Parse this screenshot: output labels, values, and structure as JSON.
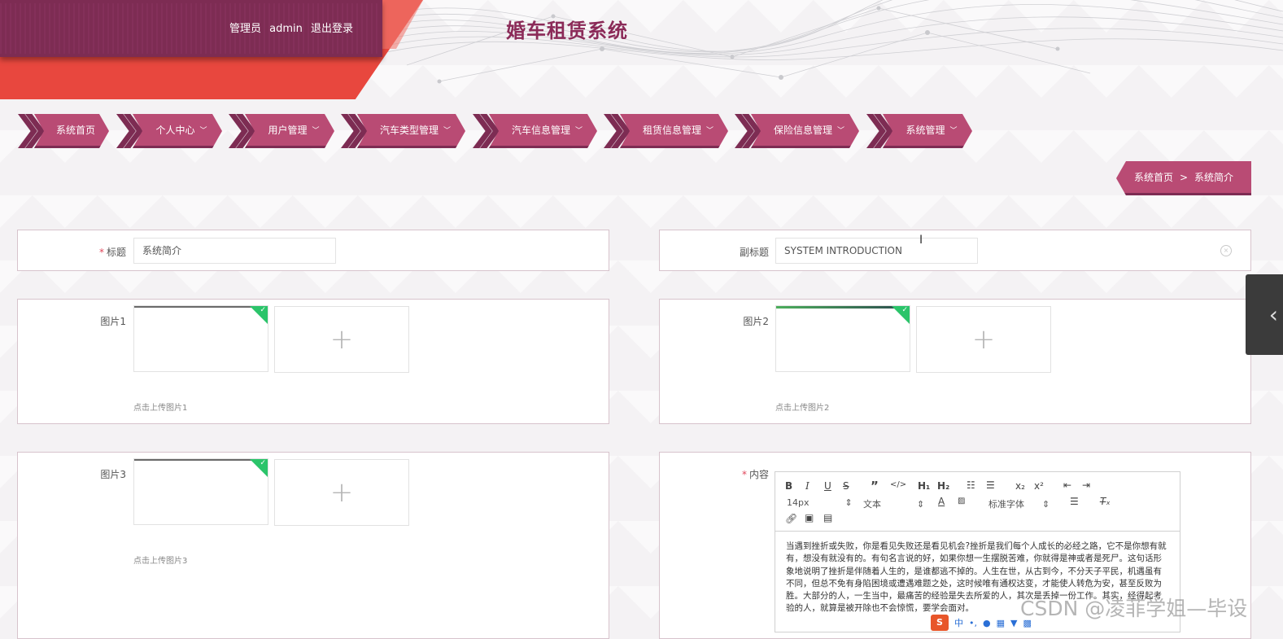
{
  "header": {
    "role_label": "管理员",
    "username": "admin",
    "logout_label": "退出登录",
    "site_title": "婚车租赁系统"
  },
  "nav": {
    "items": [
      {
        "label": "系统首页",
        "has_dropdown": false
      },
      {
        "label": "个人中心",
        "has_dropdown": true
      },
      {
        "label": "用户管理",
        "has_dropdown": true
      },
      {
        "label": "汽车类型管理",
        "has_dropdown": true
      },
      {
        "label": "汽车信息管理",
        "has_dropdown": true
      },
      {
        "label": "租赁信息管理",
        "has_dropdown": true
      },
      {
        "label": "保险信息管理",
        "has_dropdown": true
      },
      {
        "label": "系统管理",
        "has_dropdown": true
      }
    ]
  },
  "breadcrumb": {
    "home": "系统首页",
    "separator": ">",
    "current": "系统简介"
  },
  "form": {
    "title_label": "标题",
    "title_value": "系统简介",
    "subtitle_label": "副标题",
    "subtitle_value": "SYSTEM INTRODUCTION",
    "image1_label": "图片1",
    "image1_hint": "点击上传图片1",
    "image2_label": "图片2",
    "image2_hint": "点击上传图片2",
    "image3_label": "图片3",
    "image3_hint": "点击上传图片3",
    "content_label": "内容",
    "required_mark": "*",
    "add_icon": "+"
  },
  "editor": {
    "font_size": "14px",
    "text_type": "文本",
    "font_family": "标准字体",
    "content": "当遇到挫折或失败，你是看见失败还是看见机会?挫折是我们每个人成长的必经之路，它不是你想有就有，想没有就没有的。有句名言说的好，如果你想一生摆脱苦难，你就得是神或者是死尸。这句话形象地说明了挫折是伴随着人生的，是谁都逃不掉的。人生在世，从古到今，不分天子平民，机遇虽有不同，但总不免有身陷困境或遭遇难题之处，这时候唯有通权达变，才能使人转危为安，甚至反败为胜。大部分的人，一生当中，最痛苦的经验是失去所爱的人，其次是丢掉一份工作。其实，经得起考验的人，就算是被开除也不会惊慌，要学会面对。"
  },
  "ime": {
    "logo": "S",
    "mode": "中"
  },
  "watermark": "CSDN @凌菲学姐—毕设",
  "colors": {
    "brand_plum": "#7d2c53",
    "nav_pink": "#b94b74",
    "accent_red": "#e8473e",
    "title_color": "#8b2a58",
    "upload_ok": "#2bc46a"
  }
}
